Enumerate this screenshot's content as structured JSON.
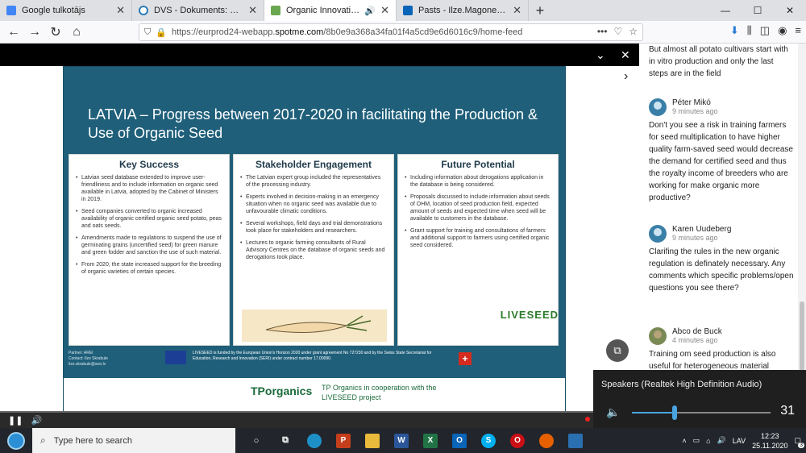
{
  "tabs": [
    {
      "title": "Google tulkotājs",
      "color": "#4285f4",
      "active": false
    },
    {
      "title": "DVS - Dokuments: nav reģistrēts",
      "color": "#2b7bb9",
      "active": false
    },
    {
      "title": "Organic Innovation Days - S",
      "color": "#6aa84f",
      "active": true
    },
    {
      "title": "Pasts - Ilze.Magone@zm.gov.lv",
      "color": "#0a64b8",
      "active": false
    }
  ],
  "window_controls": {
    "minimize": "—",
    "maximize": "☐",
    "close": "✕"
  },
  "newtab_label": "+",
  "nav": {
    "url_prefix": "https://eurprod24-webapp.",
    "url_host": "spotme.com",
    "url_path": "/8b0e9a368a34fa01f4a5cd9e6d6016c9/home-feed",
    "menu_dots": "•••"
  },
  "slide": {
    "title": "LATVIA – Progress between 2017-2020 in facilitating the Production & Use of Organic Seed",
    "columns": [
      {
        "heading": "Key Success",
        "items": [
          "Latvian seed database extended to improve user-friendliness and to include information on organic seed available in Latvia, adopted by the Cabinet of Ministers in 2019.",
          "Seed companies converted to organic increased availability of organic certified organic seed potato, peas and oats seeds.",
          "Amendments made to regulations to suspend the use of germinating grains (uncertified seed) for green manure and green fodder and sanction the use of such material.",
          "From 2020, the state increased support for the breeding of organic varieties of certain species."
        ]
      },
      {
        "heading": "Stakeholder Engagement",
        "items": [
          "The Latvian expert group included the representatives of the processing industry.",
          "Experts involved in decision-making in an emergency situation when no organic seed was available due to unfavourable climatic conditions.",
          "Several workshops, field days and trial demonstrations took place for stakeholders and researchers.",
          "Lectures to organic farming consultants of Rural Advisory Centres on the database of organic seeds and derogations took place."
        ]
      },
      {
        "heading": "Future Potential",
        "items": [
          "Including information about derogations application in the database is being considered.",
          "Proposals discussed to include information about seeds of OHM, location of seed production field, expected amount of seeds and expected time when seed will be available to customers in the database.",
          "Grant support for training and consultations of farmers and additional support to farmers using certified organic seed considered."
        ]
      }
    ],
    "partner": "Partner: AREI\nContact: Ilze Skrabule\nilze.skrabule@arei.lv",
    "funding": "LIVESEED is funded by the European Union's Horizon 2020 under grant agreement No 727230 and by the Swiss State Secretariat for Education, Research and Innovation (SERI) under contract number 17.00090.",
    "liveseed_logo": "LIVESEED",
    "tp_logo": "TPorganics",
    "tp_text": "TP Organics in cooperation with the LIVESEED project"
  },
  "comments_panel": {
    "top_text": "But almost all potato cultivars start with in vitro production and only the last steps are in the field",
    "comments": [
      {
        "name": "Péter Mikó",
        "time": "9 minutes ago",
        "text": "Don't you see a risk in training farmers for seed multiplication to have higher quality farm-saved seed would decrease the demand for certified seed and thus the royalty income of breeders who are working for make organic more productive?"
      },
      {
        "name": "Karen Uudeberg",
        "time": "9 minutes ago",
        "text": "Clarifing the rules in the new organic regulation is definately necessary. Any comments which specific problems/open questions you see there?"
      },
      {
        "name": "Abco de Buck",
        "time": "4 minutes ago",
        "text": "Training om seed production is also useful for heterogeneous material"
      }
    ]
  },
  "volume_popup": {
    "device": "Speakers (Realtek High Definition Audio)",
    "value": "31",
    "level": 0.31
  },
  "taskbar": {
    "search_placeholder": "Type here to search",
    "language": "LAV",
    "time": "12:23",
    "date": "25.11.2020",
    "notification_count": "3"
  }
}
